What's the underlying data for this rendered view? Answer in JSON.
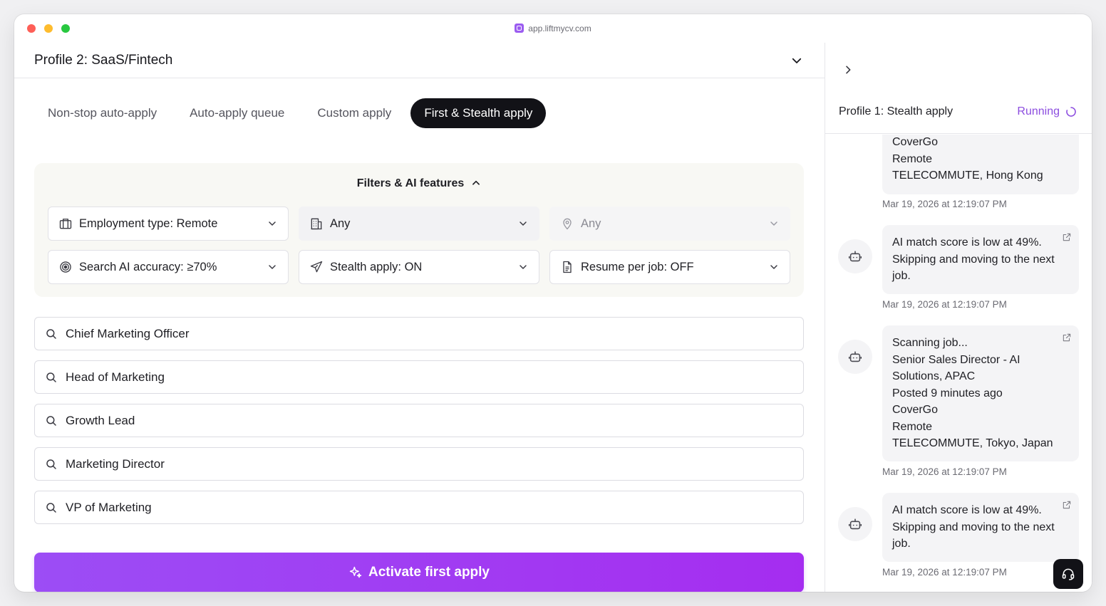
{
  "browser": {
    "url": "app.liftmycv.com"
  },
  "profile": {
    "title": "Profile 2: SaaS/Fintech"
  },
  "tabs": [
    {
      "label": "Non-stop auto-apply",
      "active": false
    },
    {
      "label": "Auto-apply queue",
      "active": false
    },
    {
      "label": "Custom apply",
      "active": false
    },
    {
      "label": "First & Stealth apply",
      "active": true
    }
  ],
  "filters": {
    "title": "Filters & AI features",
    "employment_type": "Employment type:  Remote",
    "industry": "Any",
    "location": "Any",
    "search_accuracy": "Search AI accuracy:  ≥70%",
    "stealth_apply": "Stealth apply:  ON",
    "resume_per_job": "Resume per job:  OFF"
  },
  "searches": [
    "Chief Marketing Officer",
    "Head of Marketing",
    "Growth Lead",
    "Marketing Director",
    "VP of Marketing"
  ],
  "activate_label": "Activate first apply",
  "activity": {
    "profile_title": "Profile 1: Stealth apply",
    "status": "Running",
    "entries": [
      {
        "lines": [
          "CoverGo",
          "Remote",
          "TELECOMMUTE, Hong Kong"
        ],
        "timestamp": "Mar 19, 2026 at 12:19:07 PM"
      },
      {
        "lines": [
          "AI match score is low at 49%.",
          "Skipping and moving to the next",
          "job."
        ],
        "timestamp": "Mar 19, 2026 at 12:19:07 PM"
      },
      {
        "lines": [
          "Scanning job...",
          "Senior Sales Director - AI",
          "Solutions, APAC",
          "Posted 9 minutes ago",
          "CoverGo",
          "Remote",
          "TELECOMMUTE, Tokyo, Japan"
        ],
        "timestamp": "Mar 19, 2026 at 12:19:07 PM"
      },
      {
        "lines": [
          "AI match score is low at 49%.",
          "Skipping and moving to the next",
          "job."
        ],
        "timestamp": "Mar 19, 2026 at 12:19:07 PM"
      }
    ]
  },
  "colors": {
    "accent": "#9c4df5",
    "running": "#8c4ddf",
    "dark": "#121217"
  }
}
